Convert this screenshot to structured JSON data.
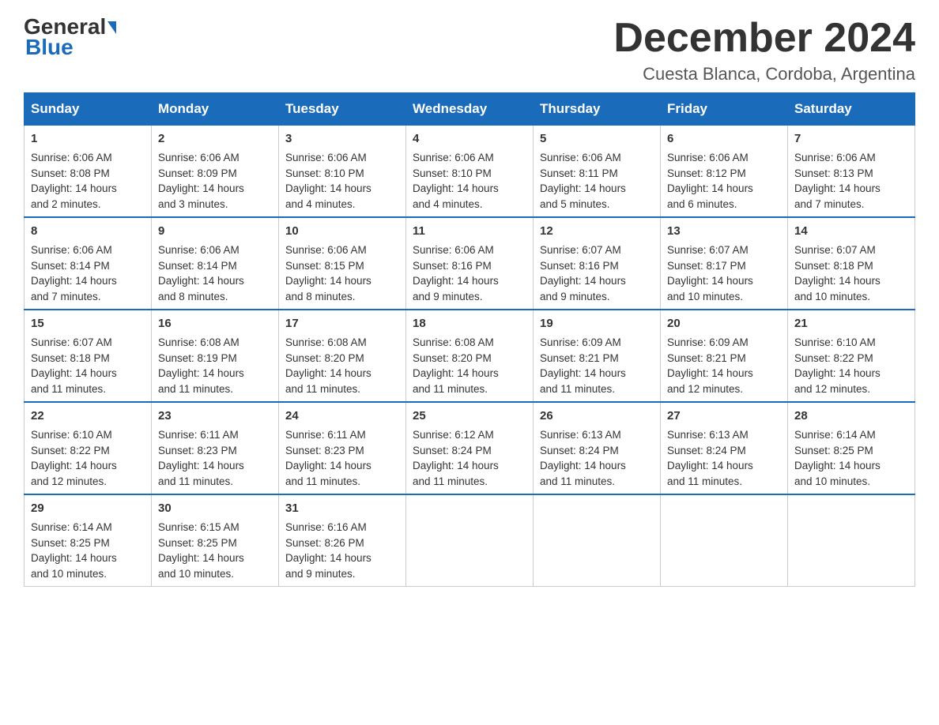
{
  "logo": {
    "general": "General",
    "blue": "Blue"
  },
  "title": "December 2024",
  "location": "Cuesta Blanca, Cordoba, Argentina",
  "days_of_week": [
    "Sunday",
    "Monday",
    "Tuesday",
    "Wednesday",
    "Thursday",
    "Friday",
    "Saturday"
  ],
  "weeks": [
    [
      {
        "day": "1",
        "sunrise": "6:06 AM",
        "sunset": "8:08 PM",
        "daylight": "14 hours and 2 minutes."
      },
      {
        "day": "2",
        "sunrise": "6:06 AM",
        "sunset": "8:09 PM",
        "daylight": "14 hours and 3 minutes."
      },
      {
        "day": "3",
        "sunrise": "6:06 AM",
        "sunset": "8:10 PM",
        "daylight": "14 hours and 4 minutes."
      },
      {
        "day": "4",
        "sunrise": "6:06 AM",
        "sunset": "8:10 PM",
        "daylight": "14 hours and 4 minutes."
      },
      {
        "day": "5",
        "sunrise": "6:06 AM",
        "sunset": "8:11 PM",
        "daylight": "14 hours and 5 minutes."
      },
      {
        "day": "6",
        "sunrise": "6:06 AM",
        "sunset": "8:12 PM",
        "daylight": "14 hours and 6 minutes."
      },
      {
        "day": "7",
        "sunrise": "6:06 AM",
        "sunset": "8:13 PM",
        "daylight": "14 hours and 7 minutes."
      }
    ],
    [
      {
        "day": "8",
        "sunrise": "6:06 AM",
        "sunset": "8:14 PM",
        "daylight": "14 hours and 7 minutes."
      },
      {
        "day": "9",
        "sunrise": "6:06 AM",
        "sunset": "8:14 PM",
        "daylight": "14 hours and 8 minutes."
      },
      {
        "day": "10",
        "sunrise": "6:06 AM",
        "sunset": "8:15 PM",
        "daylight": "14 hours and 8 minutes."
      },
      {
        "day": "11",
        "sunrise": "6:06 AM",
        "sunset": "8:16 PM",
        "daylight": "14 hours and 9 minutes."
      },
      {
        "day": "12",
        "sunrise": "6:07 AM",
        "sunset": "8:16 PM",
        "daylight": "14 hours and 9 minutes."
      },
      {
        "day": "13",
        "sunrise": "6:07 AM",
        "sunset": "8:17 PM",
        "daylight": "14 hours and 10 minutes."
      },
      {
        "day": "14",
        "sunrise": "6:07 AM",
        "sunset": "8:18 PM",
        "daylight": "14 hours and 10 minutes."
      }
    ],
    [
      {
        "day": "15",
        "sunrise": "6:07 AM",
        "sunset": "8:18 PM",
        "daylight": "14 hours and 11 minutes."
      },
      {
        "day": "16",
        "sunrise": "6:08 AM",
        "sunset": "8:19 PM",
        "daylight": "14 hours and 11 minutes."
      },
      {
        "day": "17",
        "sunrise": "6:08 AM",
        "sunset": "8:20 PM",
        "daylight": "14 hours and 11 minutes."
      },
      {
        "day": "18",
        "sunrise": "6:08 AM",
        "sunset": "8:20 PM",
        "daylight": "14 hours and 11 minutes."
      },
      {
        "day": "19",
        "sunrise": "6:09 AM",
        "sunset": "8:21 PM",
        "daylight": "14 hours and 11 minutes."
      },
      {
        "day": "20",
        "sunrise": "6:09 AM",
        "sunset": "8:21 PM",
        "daylight": "14 hours and 12 minutes."
      },
      {
        "day": "21",
        "sunrise": "6:10 AM",
        "sunset": "8:22 PM",
        "daylight": "14 hours and 12 minutes."
      }
    ],
    [
      {
        "day": "22",
        "sunrise": "6:10 AM",
        "sunset": "8:22 PM",
        "daylight": "14 hours and 12 minutes."
      },
      {
        "day": "23",
        "sunrise": "6:11 AM",
        "sunset": "8:23 PM",
        "daylight": "14 hours and 11 minutes."
      },
      {
        "day": "24",
        "sunrise": "6:11 AM",
        "sunset": "8:23 PM",
        "daylight": "14 hours and 11 minutes."
      },
      {
        "day": "25",
        "sunrise": "6:12 AM",
        "sunset": "8:24 PM",
        "daylight": "14 hours and 11 minutes."
      },
      {
        "day": "26",
        "sunrise": "6:13 AM",
        "sunset": "8:24 PM",
        "daylight": "14 hours and 11 minutes."
      },
      {
        "day": "27",
        "sunrise": "6:13 AM",
        "sunset": "8:24 PM",
        "daylight": "14 hours and 11 minutes."
      },
      {
        "day": "28",
        "sunrise": "6:14 AM",
        "sunset": "8:25 PM",
        "daylight": "14 hours and 10 minutes."
      }
    ],
    [
      {
        "day": "29",
        "sunrise": "6:14 AM",
        "sunset": "8:25 PM",
        "daylight": "14 hours and 10 minutes."
      },
      {
        "day": "30",
        "sunrise": "6:15 AM",
        "sunset": "8:25 PM",
        "daylight": "14 hours and 10 minutes."
      },
      {
        "day": "31",
        "sunrise": "6:16 AM",
        "sunset": "8:26 PM",
        "daylight": "14 hours and 9 minutes."
      },
      null,
      null,
      null,
      null
    ]
  ],
  "labels": {
    "sunrise": "Sunrise:",
    "sunset": "Sunset:",
    "daylight": "Daylight:"
  }
}
